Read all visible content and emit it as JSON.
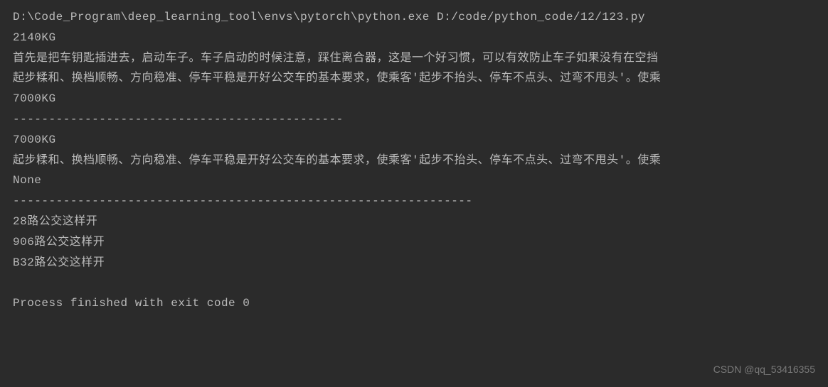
{
  "console": {
    "lines": [
      "D:\\Code_Program\\deep_learning_tool\\envs\\pytorch\\python.exe D:/code/python_code/12/123.py",
      "2140KG",
      "首先是把车钥匙插进去，启动车子。车子启动的时候注意，踩住离合器，这是一个好习惯，可以有效防止车子如果没有在空挡",
      "起步糅和、换档顺畅、方向稳准、停车平稳是开好公交车的基本要求，使乘客'起步不抬头、停车不点头、过弯不甩头'。使乘",
      "7000KG",
      "----------------------------------------------",
      "7000KG",
      "起步糅和、换档顺畅、方向稳准、停车平稳是开好公交车的基本要求，使乘客'起步不抬头、停车不点头、过弯不甩头'。使乘",
      "None",
      "----------------------------------------------------------------",
      "28路公交这样开",
      "906路公交这样开",
      "B32路公交这样开",
      "",
      "Process finished with exit code 0"
    ]
  },
  "watermark": "CSDN @qq_53416355"
}
